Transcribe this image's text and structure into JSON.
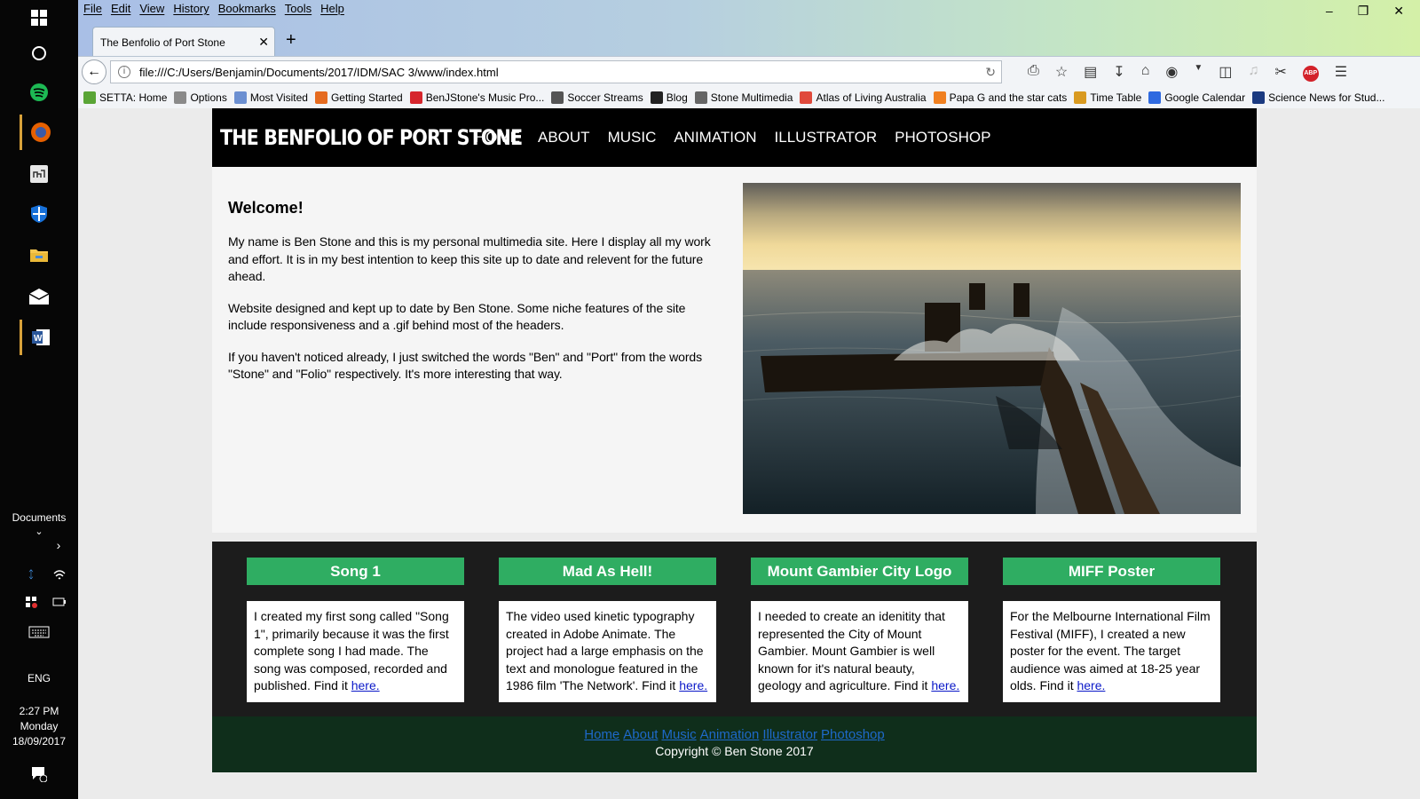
{
  "taskbar": {
    "apps": [
      {
        "name": "windows-start",
        "icon": "windows-icon"
      },
      {
        "name": "cortana",
        "icon": "circle-icon"
      },
      {
        "name": "spotify",
        "icon": "spotify-icon"
      },
      {
        "name": "firefox",
        "icon": "firefox-icon"
      },
      {
        "name": "app",
        "icon": "app-icon"
      },
      {
        "name": "defender",
        "icon": "shield-icon"
      },
      {
        "name": "file-explorer",
        "icon": "folder-icon"
      },
      {
        "name": "mail",
        "icon": "mail-icon"
      },
      {
        "name": "word",
        "icon": "word-icon"
      }
    ],
    "documents_label": "Documents",
    "language": "ENG",
    "time": "2:27 PM",
    "day": "Monday",
    "date": "18/09/2017"
  },
  "browser": {
    "menu": [
      "File",
      "Edit",
      "View",
      "History",
      "Bookmarks",
      "Tools",
      "Help"
    ],
    "tab_title": "The Benfolio of Port Stone",
    "url": "file:///C:/Users/Benjamin/Documents/2017/IDM/SAC 3/www/index.html",
    "bookmarks": [
      {
        "label": "SETTA: Home",
        "color": "#5aa536"
      },
      {
        "label": "Options",
        "color": "#8a8a8a"
      },
      {
        "label": "Most Visited",
        "color": "#6b8fd1"
      },
      {
        "label": "Getting Started",
        "color": "#e56b1f"
      },
      {
        "label": "BenJStone's Music Pro...",
        "color": "#d6262d"
      },
      {
        "label": "Soccer Streams",
        "color": "#555555"
      },
      {
        "label": "Blog",
        "color": "#222222"
      },
      {
        "label": "Stone Multimedia",
        "color": "#666666"
      },
      {
        "label": "Atlas of Living Australia",
        "color": "#e04a3c"
      },
      {
        "label": "Papa G and the star cats",
        "color": "#f08020"
      },
      {
        "label": "Time Table",
        "color": "#d99a20"
      },
      {
        "label": "Google Calendar",
        "color": "#2f6ae0"
      },
      {
        "label": "Science News for Stud...",
        "color": "#1b3a80"
      }
    ]
  },
  "site": {
    "title": "THE BENFOLIO OF PORT STONE",
    "nav": [
      "HOME",
      "ABOUT",
      "MUSIC",
      "ANIMATION",
      "ILLUSTRATOR",
      "PHOTOSHOP"
    ],
    "welcome_heading": "Welcome!",
    "paragraphs": [
      "My name is Ben Stone and this is my personal multimedia site. Here I display all my work and effort. It is in my best intention to keep this site up to date and relevent for the future ahead.",
      "Website designed and kept up to date by Ben Stone. Some niche features of the site include responsiveness and a .gif behind most of the headers.",
      "If you haven't noticed already, I just switched the words \"Ben\" and \"Port\" from the words \"Stone\" and \"Folio\" respectively. It's more interesting that way."
    ],
    "cards": [
      {
        "title": "Song 1",
        "text": "I created my first song called \"Song 1\", primarily because it was the first complete song I had made. The song was composed, recorded and published. Find it ",
        "link": "here."
      },
      {
        "title": "Mad As Hell!",
        "text": "The video used kinetic typography created in Adobe Animate. The project had a large emphasis on the text and monologue featured in the 1986 film 'The Network'. Find it ",
        "link": "here."
      },
      {
        "title": "Mount Gambier City Logo",
        "text": "I needed to create an idenitity that represented the City of Mount Gambier. Mount Gambier is well known for it's natural beauty, geology and agriculture. Find it ",
        "link": "here."
      },
      {
        "title": "MIFF Poster",
        "text": "For the Melbourne International Film Festival (MIFF), I created a new poster for the event. The target audience was aimed at 18-25 year olds. Find it ",
        "link": "here."
      }
    ],
    "footer_links": [
      "Home",
      "About",
      "Music",
      "Animation",
      "Illustrator",
      "Photoshop"
    ],
    "copyright": "Copyright © Ben Stone 2017"
  }
}
